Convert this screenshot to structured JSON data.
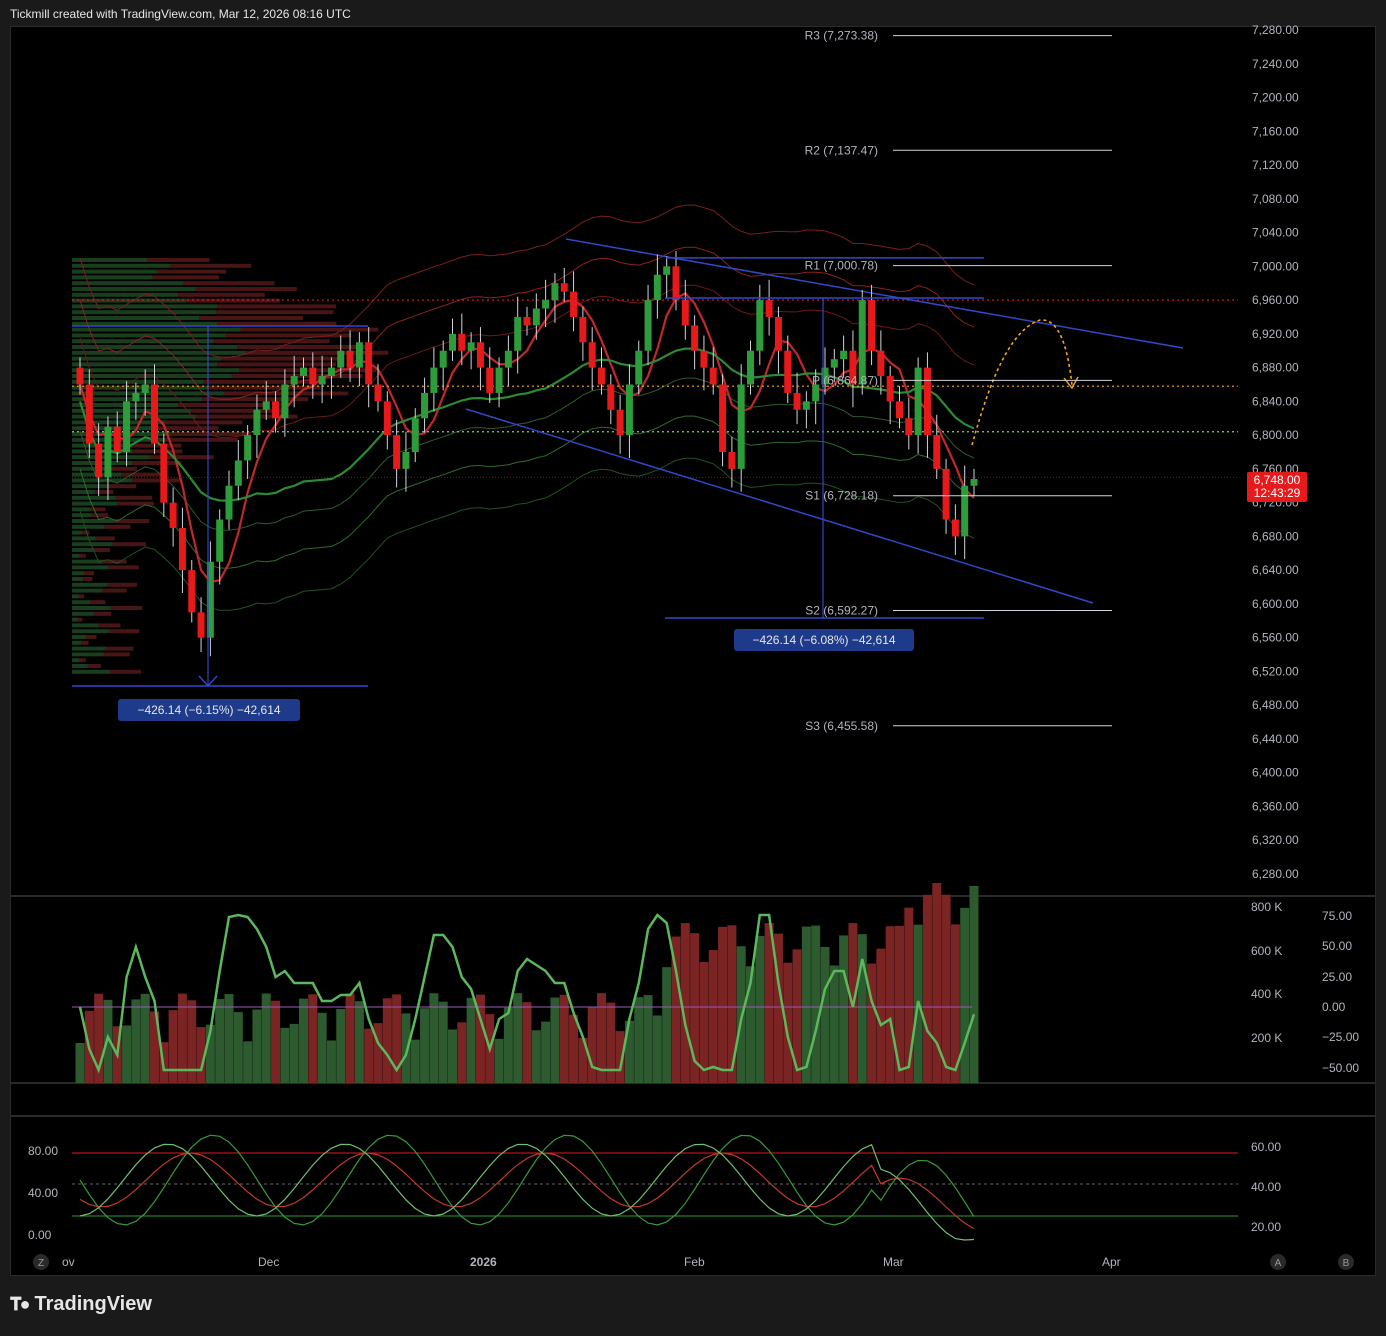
{
  "header": {
    "caption": "Tickmill created with TradingView.com, Mar 12, 2026 08:16 UTC"
  },
  "footer": {
    "brand": "TradingView",
    "logo_icon": "tradingview-logo-icon"
  },
  "colors": {
    "up": "#2e9c3a",
    "down": "#e6191b",
    "trendline": "#3347c9",
    "projection": "#f5a623",
    "pivot_line": "#d1d4dc",
    "price_badge": "#e6191b"
  },
  "price_axis": {
    "ticks": [
      "7,280.00",
      "7,240.00",
      "7,200.00",
      "7,160.00",
      "7,120.00",
      "7,080.00",
      "7,040.00",
      "7,000.00",
      "6,960.00",
      "6,920.00",
      "6,880.00",
      "6,840.00",
      "6,800.00",
      "6,760.00",
      "6,720.00",
      "6,680.00",
      "6,640.00",
      "6,600.00",
      "6,560.00",
      "6,520.00",
      "6,480.00",
      "6,440.00",
      "6,400.00",
      "6,360.00",
      "6,320.00",
      "6,280.00"
    ],
    "last_price": "6,748.00",
    "countdown": "12:43:29"
  },
  "pivots": [
    {
      "label": "R3 (7,273.38)",
      "value": 7273.38
    },
    {
      "label": "R2 (7,137.47)",
      "value": 7137.47
    },
    {
      "label": "R1 (7,000.78)",
      "value": 7000.78
    },
    {
      "label": "P (6,864.87)",
      "value": 6864.87
    },
    {
      "label": "S1 (6,728.18)",
      "value": 6728.18
    },
    {
      "label": "S2 (6,592.27)",
      "value": 6592.27
    },
    {
      "label": "S3 (6,455.58)",
      "value": 6455.58
    }
  ],
  "measurements": [
    {
      "label": "−426.14 (−6.15%) −42,614"
    },
    {
      "label": "−426.14 (−6.08%) −42,614"
    }
  ],
  "volume_axis": {
    "ticks": [
      "800 K",
      "600 K",
      "400 K",
      "200 K"
    ]
  },
  "oscillator_axis": {
    "ticks": [
      "75.00",
      "50.00",
      "25.00",
      "0.00",
      "−25.00",
      "−50.00"
    ]
  },
  "stoch_axis": {
    "left_ticks": [
      "80.00",
      "40.00",
      "0.00"
    ],
    "right_ticks": [
      "60.00",
      "40.00",
      "20.00"
    ]
  },
  "time_axis": {
    "labels": [
      "ov",
      "Dec",
      "2026",
      "Feb",
      "Mar",
      "Apr"
    ]
  },
  "buttons": {
    "z": "Z",
    "a": "A",
    "b": "B"
  },
  "chart_data": {
    "type": "candlestick",
    "instrument_note": "daily candles with volume, oscillator and stochastic sub-panes",
    "ylim": [
      6260,
      7290
    ],
    "series_close_approx": [
      6860,
      6790,
      6750,
      6810,
      6780,
      6840,
      6850,
      6860,
      6790,
      6720,
      6690,
      6640,
      6590,
      6560,
      6650,
      6700,
      6740,
      6770,
      6800,
      6830,
      6840,
      6820,
      6860,
      6870,
      6880,
      6860,
      6870,
      6880,
      6900,
      6880,
      6910,
      6860,
      6840,
      6800,
      6760,
      6780,
      6820,
      6850,
      6880,
      6900,
      6920,
      6900,
      6910,
      6880,
      6850,
      6880,
      6900,
      6940,
      6930,
      6950,
      6960,
      6980,
      6970,
      6940,
      6910,
      6880,
      6860,
      6830,
      6800,
      6860,
      6900,
      6960,
      6990,
      7000,
      6960,
      6930,
      6900,
      6880,
      6860,
      6780,
      6760,
      6860,
      6900,
      6960,
      6940,
      6900,
      6850,
      6830,
      6840,
      6860,
      6880,
      6890,
      6900,
      6860,
      6960,
      6900,
      6870,
      6840,
      6820,
      6800,
      6880,
      6800,
      6760,
      6700,
      6680,
      6740,
      6748
    ]
  }
}
